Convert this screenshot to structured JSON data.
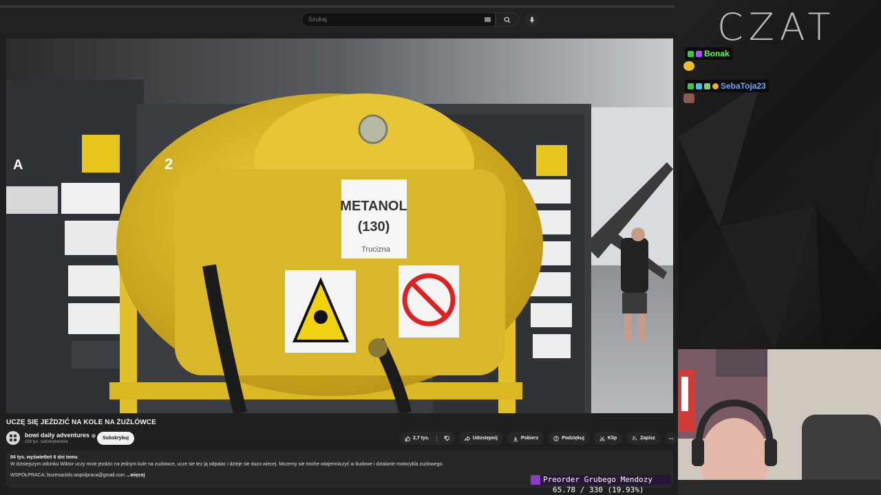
{
  "search": {
    "placeholder": "Szukaj"
  },
  "video": {
    "title": "UCZĘ SIĘ JEŹDZIĆ NA KOLE NA ŻUŻLÓWCE",
    "sign_line1": "METANOL",
    "sign_line2": "(130)",
    "sign_line3": "Trucizna"
  },
  "channel": {
    "name": "bowi daily adventures",
    "subs": "159 tys. subskrybentów",
    "subscribe_label": "Subskrybuj"
  },
  "actions": {
    "likes": "2,7 tys.",
    "share": "Udostępnij",
    "download": "Pobierz",
    "thanks": "Podziękuj",
    "clip": "Klip",
    "save": "Zapisz"
  },
  "description": {
    "meta": "84 tys. wyświetleń  6 dni temu",
    "text": "W dzisiejszym odcinku Wiktor uczy mnie jezdzic na jednym kole na zuzlowce, ucze sie tez ją odpalac i dzieje sie duzo wiecej. Mozemy sie troche wtajemniczyć w budowe i dzialanie motocykla zuzlowego.",
    "collab": "WSPÓŁPRACA: bozenacislo.wspolpraca@gmail.com",
    "more": "...więcej"
  },
  "chat": {
    "title": "CZAT",
    "messages": [
      {
        "user": "Bonak",
        "color": "#55ff55"
      },
      {
        "user": "SebaToja23",
        "color": "#66aaff"
      }
    ]
  },
  "overlay": {
    "label": "Preorder Grubego Mendozy",
    "progress": "65.78 / 330 (19.93%)"
  },
  "colors": {
    "accent_purple": "#8a3cc9",
    "tank_yellow": "#e7c52b"
  }
}
